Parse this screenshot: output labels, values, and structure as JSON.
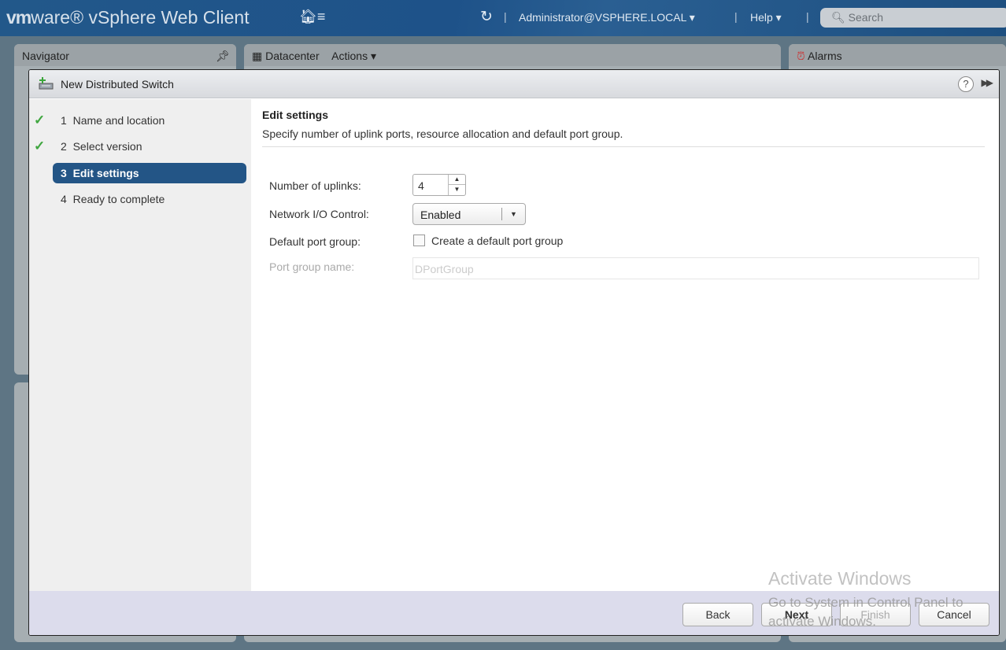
{
  "app": {
    "brand": "vm",
    "brand2": "ware",
    "title": "vSphere Web Client",
    "user": "Administrator@VSPHERE.LOCAL ▾",
    "help": "Help ▾",
    "search_placeholder": "Search"
  },
  "background": {
    "navigator": "Navigator",
    "datacenter": "Datacenter",
    "actions": "Actions ▾",
    "alarms": "Alarms"
  },
  "wizard": {
    "title": "New Distributed Switch",
    "steps": [
      {
        "num": "1",
        "label": "Name and location",
        "done": true
      },
      {
        "num": "2",
        "label": "Select version",
        "done": true
      },
      {
        "num": "3",
        "label": "Edit settings",
        "active": true
      },
      {
        "num": "4",
        "label": "Ready to complete"
      }
    ],
    "heading": "Edit settings",
    "subtitle": "Specify number of uplink ports, resource allocation and default port group.",
    "fields": {
      "uplinks_label": "Number of uplinks:",
      "uplinks_value": "4",
      "nioc_label": "Network I/O Control:",
      "nioc_value": "Enabled",
      "dpg_label": "Default port group:",
      "dpg_checkbox": "Create a default port group",
      "dpg_checked": false,
      "pg_name_label": "Port group name:",
      "pg_name_value": "DPortGroup"
    },
    "buttons": {
      "back": "Back",
      "next": "Next",
      "finish": "Finish",
      "cancel": "Cancel"
    }
  },
  "watermark": {
    "line1": "Activate Windows",
    "line2": "Go to System in Control Panel to activate Windows."
  },
  "colors": {
    "accent": "#235586",
    "check": "#3fa63f"
  }
}
